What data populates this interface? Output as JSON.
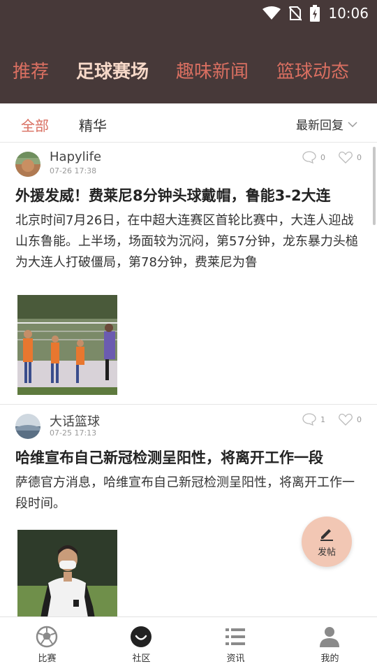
{
  "status_bar": {
    "time": "10:06"
  },
  "top_nav": {
    "tabs": [
      {
        "label": "推荐"
      },
      {
        "label": "足球赛场"
      },
      {
        "label": "趣味新闻"
      },
      {
        "label": "篮球动态"
      }
    ]
  },
  "filter_bar": {
    "tabs": [
      {
        "label": "全部"
      },
      {
        "label": "精华"
      }
    ],
    "sort_label": "最新回复"
  },
  "posts": [
    {
      "author": "Hapylife",
      "time": "07-26 17:38",
      "comments": "0",
      "likes": "0",
      "title": "外援发威！费莱尼8分钟头球戴帽，鲁能3-2大连",
      "body": "北京时间7月26日，在中超大连赛区首轮比赛中，大连人迎战山东鲁能。上半场，场面较为沉闷，第57分钟，龙东暴力头槌为大连人打破僵局，第78分钟，费莱尼为鲁"
    },
    {
      "author": "大话篮球",
      "time": "07-25 17:13",
      "comments": "1",
      "likes": "0",
      "title": "哈维宣布自己新冠检测呈阳性，将离开工作一段",
      "body": "萨德官方消息，哈维宣布自己新冠检测呈阳性，将离开工作一段时间。"
    }
  ],
  "fab": {
    "label": "发帖"
  },
  "bottom_nav": {
    "items": [
      {
        "label": "比赛",
        "icon": "soccer-ball-icon"
      },
      {
        "label": "社区",
        "icon": "community-icon"
      },
      {
        "label": "资讯",
        "icon": "news-list-icon"
      },
      {
        "label": "我的",
        "icon": "profile-icon"
      }
    ]
  },
  "colors": {
    "header_bg": "#473939",
    "tab_inactive": "#d96f61",
    "tab_active": "#f6d8c8",
    "accent": "#d96f61",
    "fab_bg": "#f2c7b4"
  }
}
